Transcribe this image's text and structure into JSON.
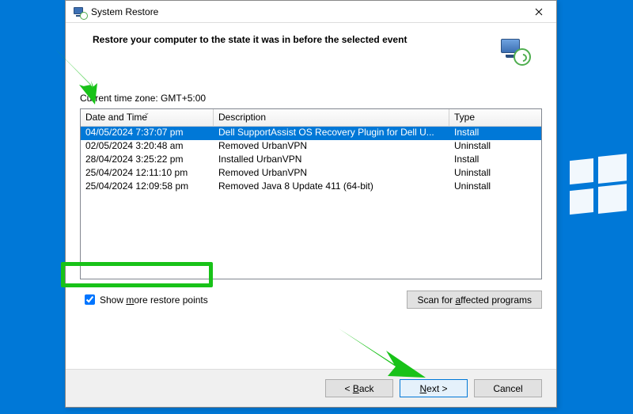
{
  "window": {
    "title": "System Restore",
    "heading": "Restore your computer to the state it was in before the selected event"
  },
  "timezone_label": "Current time zone: GMT+5:00",
  "columns": {
    "datetime": "Date and Time",
    "description": "Description",
    "type": "Type"
  },
  "rows": [
    {
      "dt": "04/05/2024 7:37:07 pm",
      "desc": "Dell SupportAssist OS Recovery Plugin for Dell U...",
      "type": "Install",
      "selected": true
    },
    {
      "dt": "02/05/2024 3:20:48 am",
      "desc": "Removed UrbanVPN",
      "type": "Uninstall",
      "selected": false
    },
    {
      "dt": "28/04/2024 3:25:22 pm",
      "desc": "Installed UrbanVPN",
      "type": "Install",
      "selected": false
    },
    {
      "dt": "25/04/2024 12:11:10 pm",
      "desc": "Removed UrbanVPN",
      "type": "Uninstall",
      "selected": false
    },
    {
      "dt": "25/04/2024 12:09:58 pm",
      "desc": "Removed Java 8 Update 411 (64-bit)",
      "type": "Uninstall",
      "selected": false
    }
  ],
  "show_more": {
    "checked": true,
    "pre": "Show ",
    "mnemonic": "m",
    "post": "ore restore points"
  },
  "scan_button": {
    "pre": "Scan for ",
    "mnemonic": "a",
    "post": "ffected programs"
  },
  "buttons": {
    "back": {
      "pre": "< ",
      "mnemonic": "B",
      "post": "ack"
    },
    "next": {
      "pre": "",
      "mnemonic": "N",
      "post": "ext >"
    },
    "cancel": "Cancel"
  }
}
